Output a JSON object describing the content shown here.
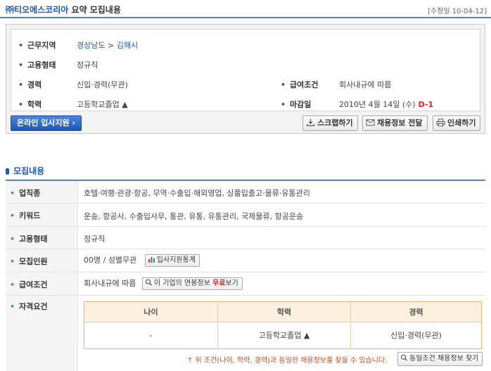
{
  "header": {
    "company": "㈜티오에스코리아",
    "title_suffix": "요약 모집내용",
    "updated": "[수정일 10-04-12]"
  },
  "summary": {
    "location_label": "근무지역",
    "location_region": "경상남도",
    "location_sep": ">",
    "location_city": "김해시",
    "employment_label": "고용형태",
    "employment_value": "정규직",
    "career_label": "경력",
    "career_value": "신입·경력(무관)",
    "salary_label": "급여조건",
    "salary_value": "회사내규에 따름",
    "education_label": "학력",
    "education_value": "고등학교졸업 ▲",
    "deadline_label": "마감일",
    "deadline_value": "2010년 4월 14일 (수)",
    "deadline_dday": "D-1"
  },
  "buttons": {
    "apply": "온라인 입사지원 ›",
    "scrap": "스크랩하기",
    "send": "채용정보 전달",
    "print": "인쇄하기"
  },
  "section": {
    "title": "모집내용"
  },
  "details": {
    "industry_label": "업직종",
    "industry_value": "호텔·여행·관광·항공, 무역·수출입·해외영업, 상품입출고·물류·유통관리",
    "keyword_label": "키워드",
    "keyword_value": "운송, 항공사, 수출입사무, 통관, 유통, 유통관리, 국제물류, 항공운송",
    "employment_label": "고용형태",
    "employment_value": "정규직",
    "headcount_label": "모집인원",
    "headcount_value": "00명 / 성별무관",
    "headcount_btn": "입사지원통계",
    "salary_label": "급여조건",
    "salary_value": "회사내규에 따름",
    "salary_btn_pre": "이 기업의 연봉정보",
    "salary_btn_free": "무료",
    "salary_btn_post": "보기",
    "qual_label": "자격요건"
  },
  "qualification": {
    "headers": [
      "나이",
      "학력",
      "경력"
    ],
    "values": [
      "-",
      "고등학교졸업 ▲",
      "신입·경력(무관)"
    ],
    "note": "↑ 위 조건(나이, 학력, 경력)과 동일한 채용정보를 찾을 수 있습니다.",
    "find_btn": "동일조건 채용정보 찾기"
  },
  "colors": {
    "accent": "#1d55b8",
    "dday": "#e02020",
    "table_header": "#fbf1de"
  }
}
